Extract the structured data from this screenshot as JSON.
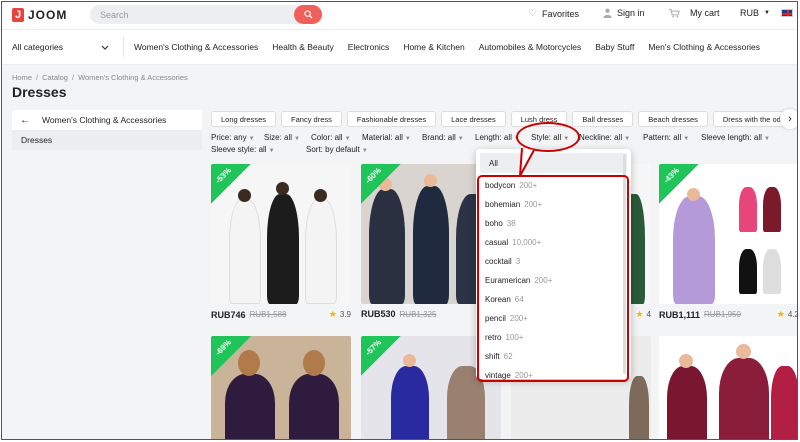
{
  "header": {
    "logo_text": "JOOM",
    "search_placeholder": "Search",
    "favorites": "Favorites",
    "sign_in": "Sign in",
    "cart": "My cart",
    "currency": "RUB"
  },
  "nav": {
    "all_categories": "All categories",
    "links": [
      "Women's Clothing & Accessories",
      "Health & Beauty",
      "Electronics",
      "Home & Kitchen",
      "Automobiles & Motorcycles",
      "Baby Stuff",
      "Men's Clothing & Accessories"
    ]
  },
  "breadcrumbs": [
    "Home",
    "/",
    "Catalog",
    "/",
    "Women's Clothing & Accessories"
  ],
  "page_title": "Dresses",
  "sidebar": {
    "back_label": "Women's Clothing & Accessories",
    "current": "Dresses"
  },
  "chips": [
    "Long dresses",
    "Fancy dress",
    "Fashionable dresses",
    "Lace dresses",
    "Lush dress",
    "Ball dresses",
    "Beach dresses",
    "Dress with the odd"
  ],
  "filters": {
    "price": "Price: any",
    "size": "Size: all",
    "color": "Color: all",
    "material": "Material: all",
    "brand": "Brand: all",
    "length": "Length: all",
    "style": "Style: all",
    "neckline": "Neckline: all",
    "pattern": "Pattern: all",
    "sleeve_length": "Sleeve length: all",
    "sleeve_style": "Sleeve style: all",
    "sort": "Sort: by default"
  },
  "products": [
    {
      "discount": "-53%",
      "price": "RUB746",
      "old_price": "RUB1,588",
      "rating": "3.9"
    },
    {
      "discount": "-60%",
      "price": "RUB530",
      "old_price": "RUB1,325",
      "rating": ""
    },
    {
      "discount": "",
      "price": "",
      "old_price": "",
      "rating": "4"
    },
    {
      "discount": "-43%",
      "price": "RUB1,111",
      "old_price": "RUB1,950",
      "rating": "4.2"
    },
    {
      "discount": "-69%"
    },
    {
      "discount": "-57%"
    }
  ],
  "style_dropdown": {
    "all_label": "All",
    "options": [
      {
        "label": "bodycon",
        "count": "200+"
      },
      {
        "label": "bohemian",
        "count": "200+"
      },
      {
        "label": "boho",
        "count": "38"
      },
      {
        "label": "casual",
        "count": "10,000+"
      },
      {
        "label": "cocktail",
        "count": "3"
      },
      {
        "label": "Euramerican",
        "count": "200+"
      },
      {
        "label": "Korean",
        "count": "64"
      },
      {
        "label": "pencil",
        "count": "200+"
      },
      {
        "label": "retro",
        "count": "100+"
      },
      {
        "label": "shift",
        "count": "62"
      },
      {
        "label": "vintage",
        "count": "200+"
      }
    ]
  },
  "colors": {
    "accent": "#f0605a",
    "discount": "#20c55a",
    "highlight": "#cc0000"
  }
}
